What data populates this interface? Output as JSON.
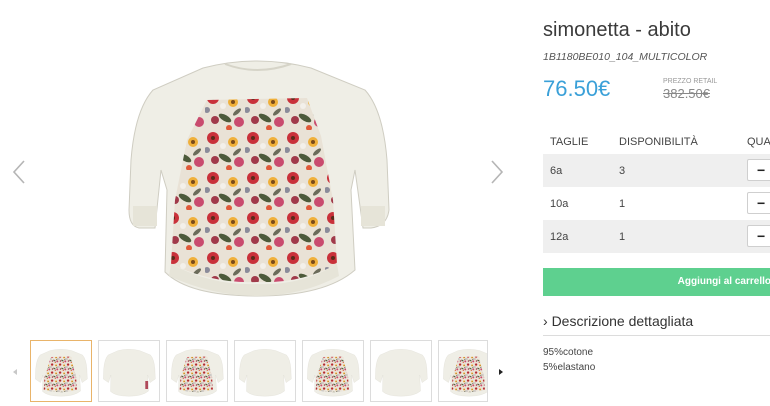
{
  "product": {
    "title": "simonetta - abito",
    "sku": "1B1180BE010_104_MULTICOLOR",
    "price": "76.50€",
    "retail_label": "PREZZO RETAIL",
    "retail_price": "382.50€"
  },
  "sizes_table": {
    "headers": {
      "size": "TAGLIE",
      "availability": "DISPONIBILITÀ",
      "quantity": "QUA"
    },
    "rows": [
      {
        "size": "6a",
        "availability": "3",
        "qty_button": "−"
      },
      {
        "size": "10a",
        "availability": "1",
        "qty_button": "−"
      },
      {
        "size": "12a",
        "availability": "1",
        "qty_button": "−"
      }
    ]
  },
  "cart": {
    "add_label": "Aggiungi al carrello"
  },
  "description": {
    "toggle_icon": "›",
    "heading": "Descrizione dettagliata",
    "lines": [
      "95%cotone",
      "5%elastano"
    ]
  },
  "gallery": {
    "prev_icon": "chevron-left-icon",
    "next_icon": "chevron-right-icon",
    "thumbnails": [
      "floral-front",
      "plain-back",
      "floral-front",
      "plain-back",
      "floral-front",
      "plain-back",
      "floral-front"
    ],
    "active_thumbnail": 0
  },
  "colors": {
    "price": "#3aa0d8",
    "add_button": "#5ed08f",
    "active_thumb_border": "#e9b46a"
  }
}
